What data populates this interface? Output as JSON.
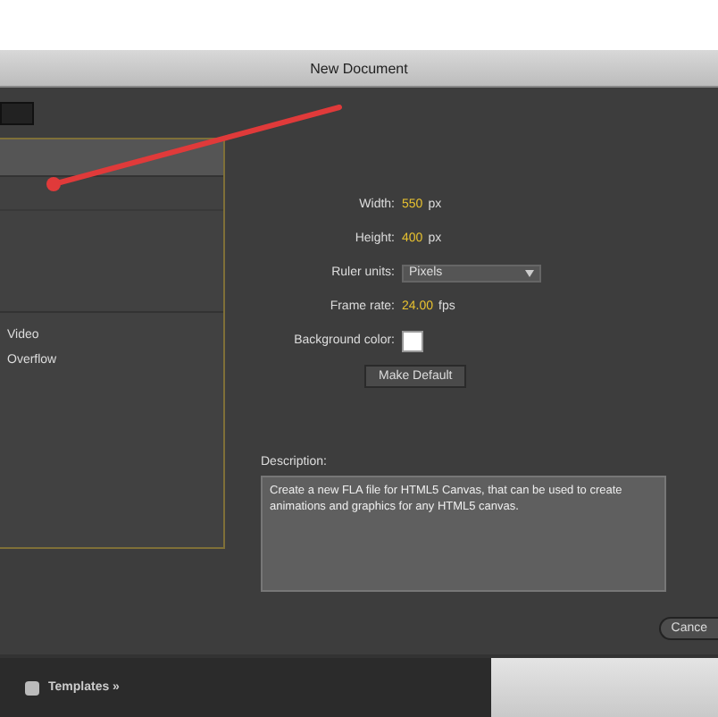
{
  "window": {
    "title": "New Document"
  },
  "list": {
    "items": [
      {
        "label": "Video",
        "selected": false
      },
      {
        "label": "Overflow",
        "selected": false
      }
    ]
  },
  "form": {
    "fields": [
      {
        "kind": "number",
        "label": "Width:",
        "value": "550",
        "unit": "px"
      },
      {
        "kind": "number",
        "label": "Height:",
        "value": "400",
        "unit": "px"
      },
      {
        "kind": "select",
        "label": "Ruler units:",
        "value": "Pixels"
      },
      {
        "kind": "number",
        "label": "Frame rate:",
        "value": "24.00",
        "unit": "fps"
      },
      {
        "kind": "color",
        "label": "Background color:"
      }
    ],
    "default_button": "Make Default",
    "description_label": "Description:",
    "description": "Create a new FLA file for HTML5 Canvas, that can be used to create animations and graphics for any HTML5 canvas."
  },
  "footer": {
    "buttons": [
      "Cance"
    ]
  },
  "bottom_bar": {
    "label": "Templates »"
  }
}
